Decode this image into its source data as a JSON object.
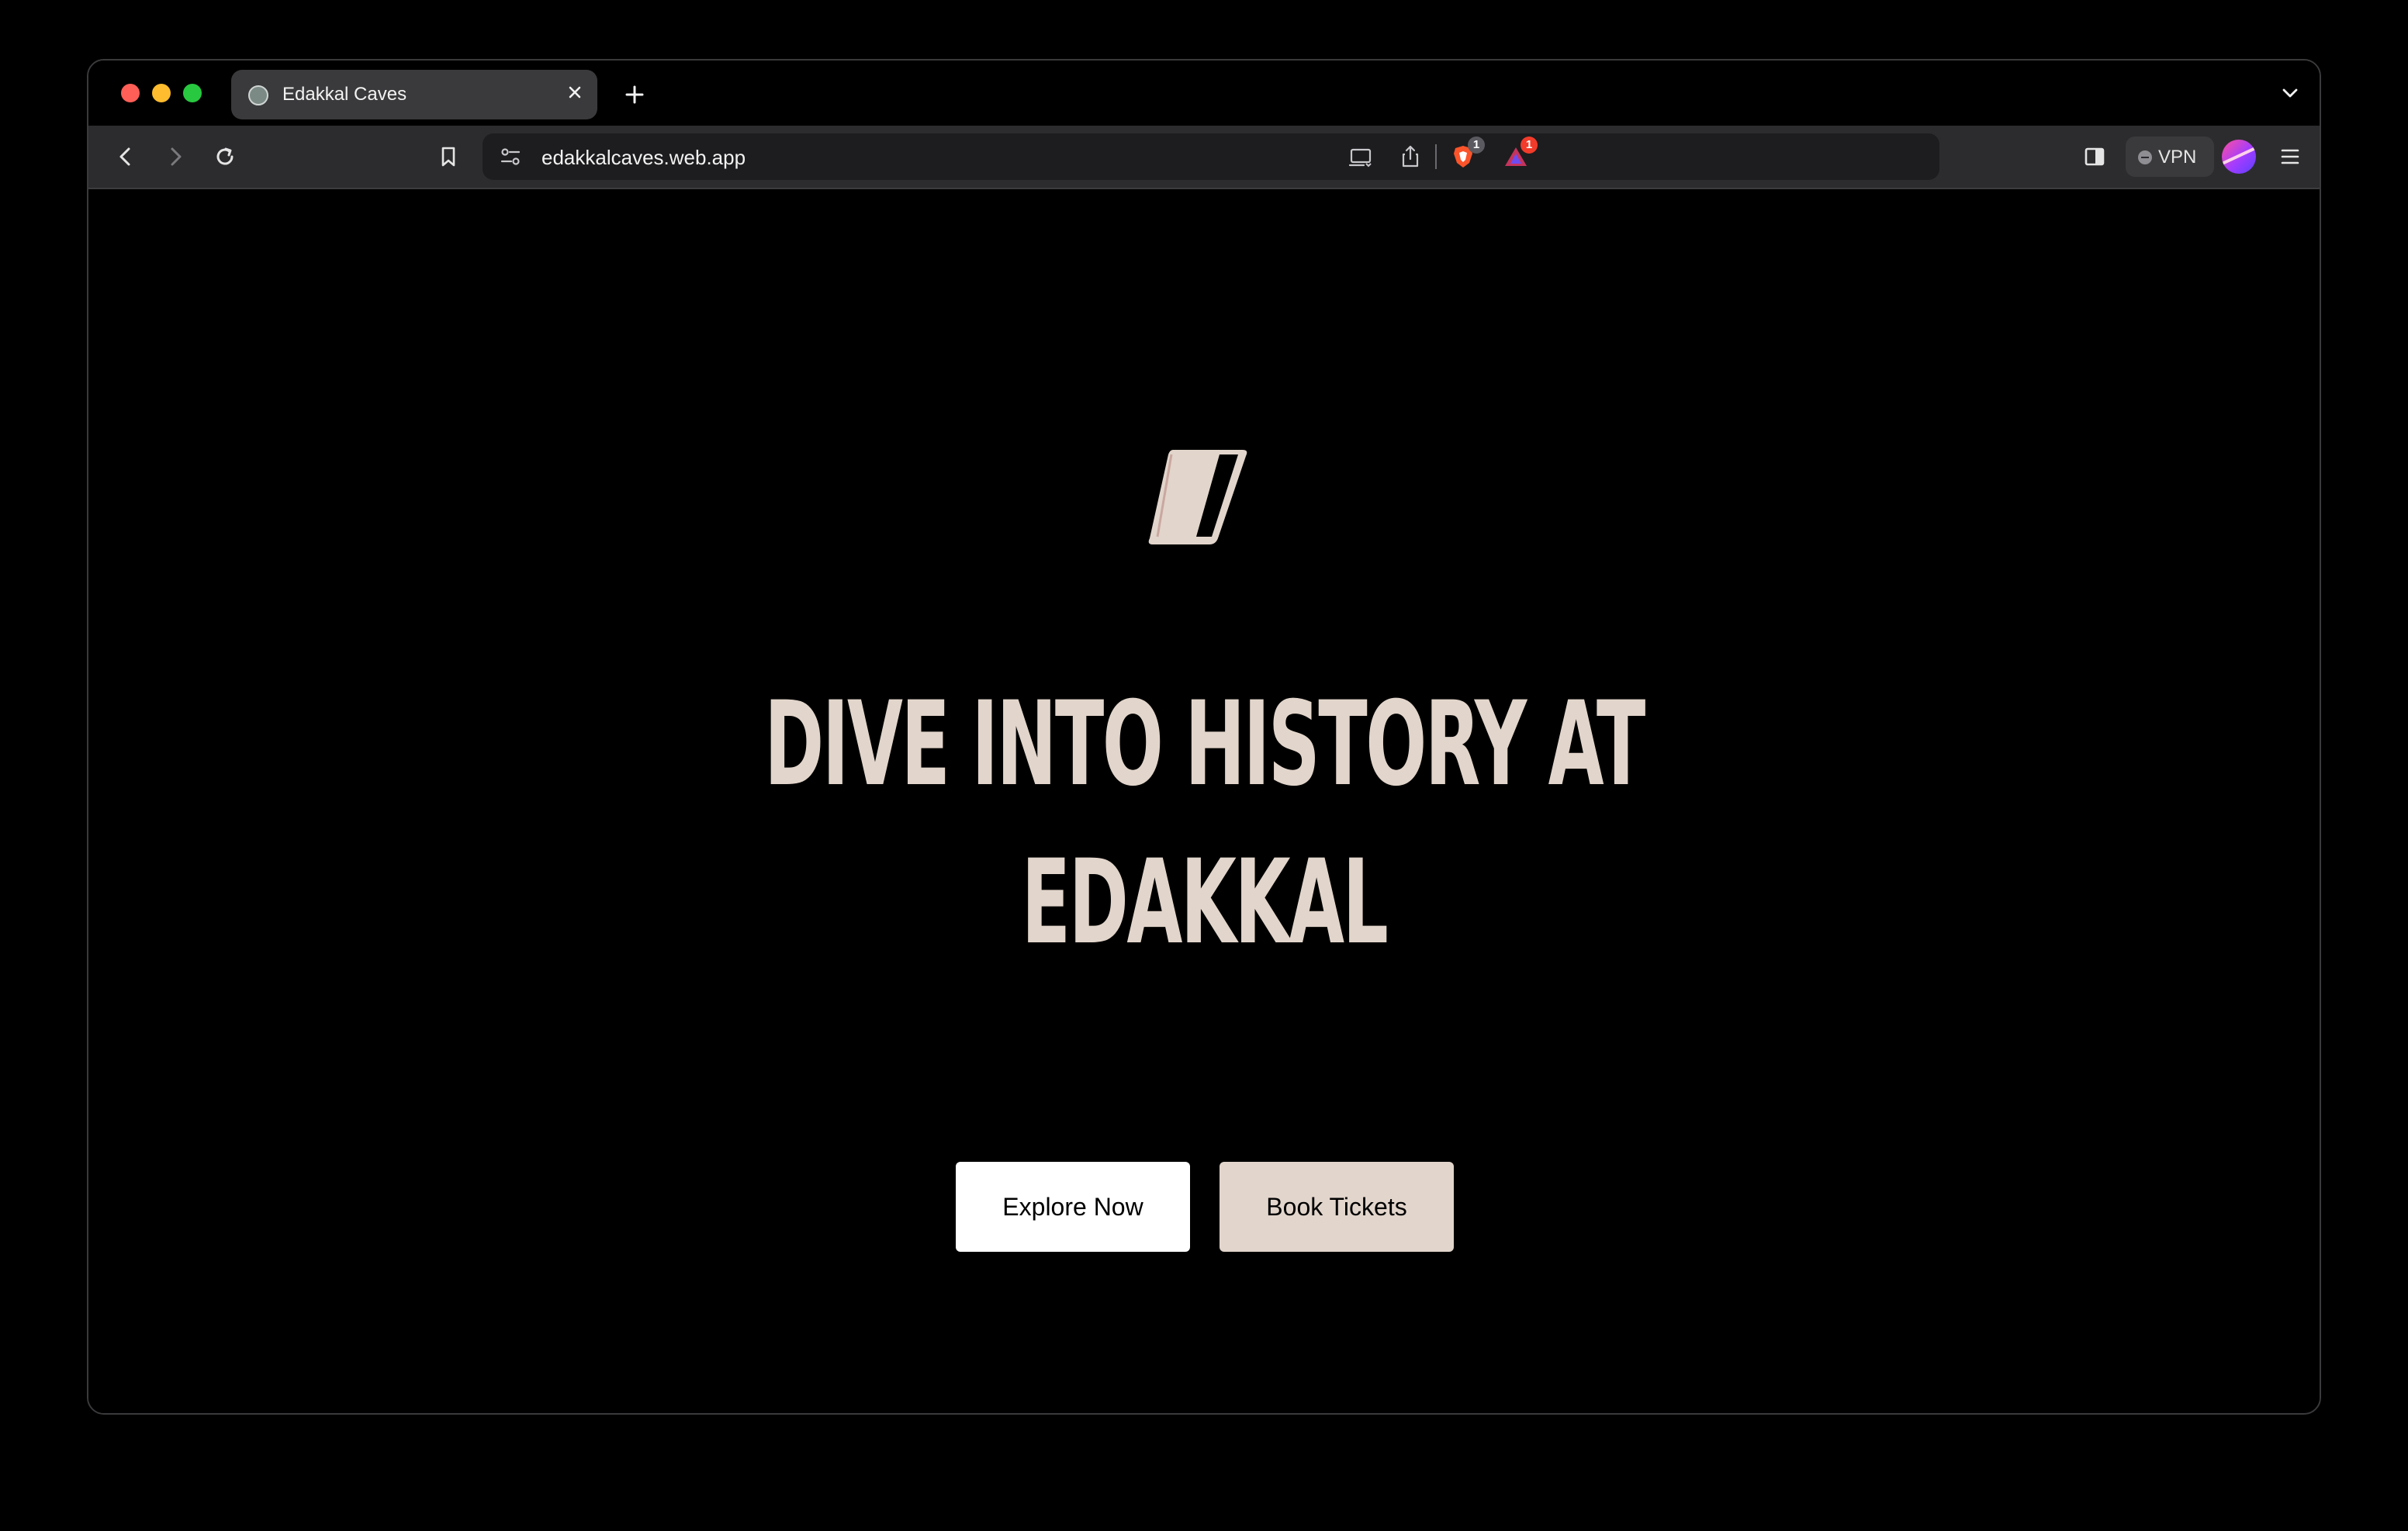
{
  "browser": {
    "tab": {
      "title": "Edakkal Caves",
      "favicon": "globe-favicon"
    },
    "url": "edakkalcaves.web.app",
    "brave_shields_badge": "1",
    "brave_rewards_badge": "1",
    "vpn_label": "VPN",
    "colors": {
      "tab_active": "#3a3a3c",
      "toolbar": "#2c2c2e",
      "address_bar": "#1d1d1f"
    }
  },
  "hero": {
    "headline_line1": "DIVE INTO HISTORY AT",
    "headline_line2": "EDAKKAL",
    "explore_label": "Explore Now",
    "book_label": "Book Tickets",
    "colors": {
      "accent": "#e2d5cb",
      "background": "#000000"
    }
  }
}
